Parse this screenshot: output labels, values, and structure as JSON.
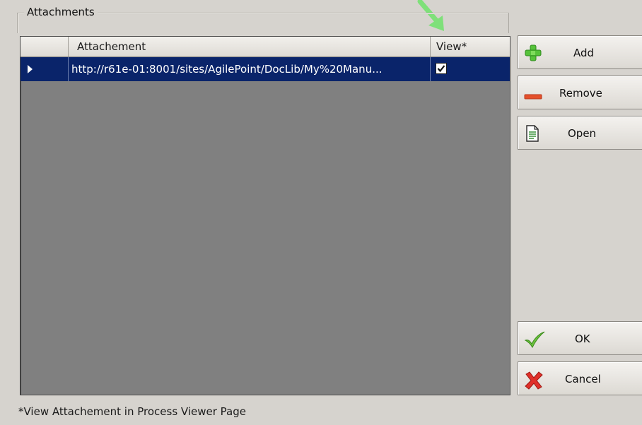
{
  "groupbox": {
    "title": "Attachments"
  },
  "grid": {
    "columns": [
      "Attachement",
      "View*"
    ],
    "rows": [
      {
        "attachment": "http://r61e-01:8001/sites/AgilePoint/DocLib/My%20Manu...",
        "view_checked": true,
        "selected": true
      }
    ]
  },
  "buttons": {
    "add": "Add",
    "remove": "Remove",
    "open": "Open",
    "ok": "OK",
    "cancel": "Cancel"
  },
  "footnote": "*View Attachement in Process Viewer Page",
  "icons": {
    "add": "plus-icon",
    "remove": "minus-icon",
    "open": "document-icon",
    "ok": "checkmark-icon",
    "cancel": "x-icon",
    "row_indicator": "row-pointer-icon",
    "annotation": "arrow-icon"
  },
  "colors": {
    "selection": "#0a246a",
    "grid_background": "#808080",
    "dialog_background": "#d6d3ce",
    "annotation_arrow": "#7fe07a"
  }
}
